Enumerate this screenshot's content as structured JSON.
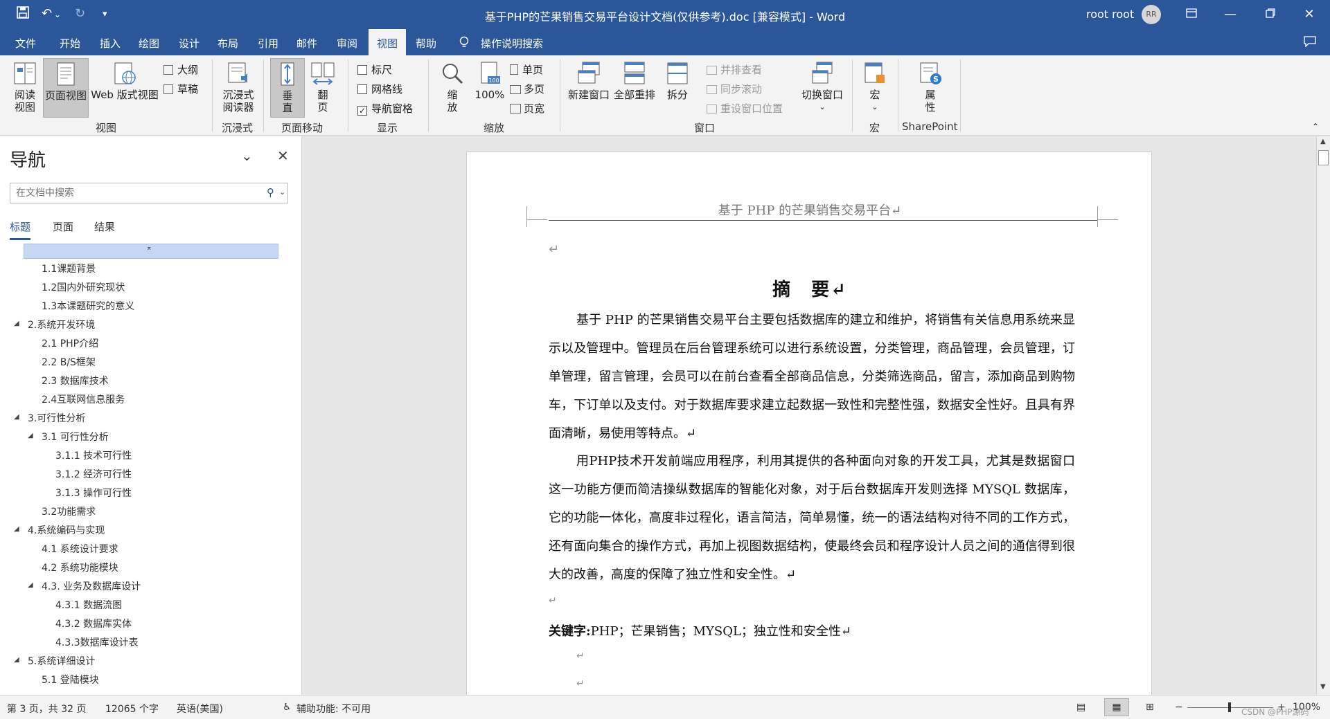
{
  "window": {
    "title": "基于PHP的芒果销售交易平台设计文档(仅供参考).doc [兼容模式]  -  Word",
    "user": "root root",
    "avatar_initials": "RR"
  },
  "menu_tabs": [
    "文件",
    "开始",
    "插入",
    "绘图",
    "设计",
    "布局",
    "引用",
    "邮件",
    "审阅",
    "视图",
    "帮助",
    "操作说明搜索"
  ],
  "ribbon": {
    "views": {
      "read_mode": "阅读\n视图",
      "print_layout": "页面视图",
      "web_layout": "Web 版式视图",
      "outline": "大纲",
      "draft": "草稿",
      "group": "视图"
    },
    "immersive": {
      "reader": "沉浸式\n阅读器",
      "group": "沉浸式"
    },
    "page_movement": {
      "vertical": "垂\n直",
      "side": "翻\n页",
      "group": "页面移动"
    },
    "show": {
      "ruler": "标尺",
      "gridlines": "网格线",
      "nav_pane": "导航窗格",
      "group": "显示"
    },
    "zoom": {
      "zoom": "缩\n放",
      "hundred": "100%",
      "one_page": "单页",
      "multi_page": "多页",
      "page_width": "页宽",
      "group": "缩放"
    },
    "window": {
      "new_window": "新建窗口",
      "arrange_all": "全部重排",
      "split": "拆分",
      "side_by_side": "并排查看",
      "sync_scroll": "同步滚动",
      "reset_pos": "重设窗口位置",
      "switch": "切换窗口",
      "group": "窗口"
    },
    "macros": {
      "macros": "宏",
      "group": "宏"
    },
    "sharepoint": {
      "properties": "属\n性",
      "group": "SharePoint"
    }
  },
  "nav": {
    "title": "导航",
    "search_placeholder": "在文档中搜索",
    "tabs": [
      "标题",
      "页面",
      "结果"
    ],
    "items": [
      {
        "label": "1.1课题背景",
        "level": 2
      },
      {
        "label": "1.2国内外研究现状",
        "level": 2
      },
      {
        "label": "1.3本课题研究的意义",
        "level": 2
      },
      {
        "label": "2.系统开发环境",
        "level": 1
      },
      {
        "label": "2.1 PHP介绍",
        "level": 2
      },
      {
        "label": "2.2 B/S框架",
        "level": 2
      },
      {
        "label": "2.3 数据库技术",
        "level": 2
      },
      {
        "label": "2.4互联网信息服务",
        "level": 2
      },
      {
        "label": "3.可行性分析",
        "level": 1
      },
      {
        "label": "3.1 可行性分析",
        "level": 2,
        "expandable": true
      },
      {
        "label": "3.1.1 技术可行性",
        "level": 3
      },
      {
        "label": "3.1.2 经济可行性",
        "level": 3
      },
      {
        "label": "3.1.3 操作可行性",
        "level": 3
      },
      {
        "label": "3.2功能需求",
        "level": 2
      },
      {
        "label": "4.系统编码与实现",
        "level": 1
      },
      {
        "label": "4.1 系统设计要求",
        "level": 2
      },
      {
        "label": "4.2 系统功能模块",
        "level": 2
      },
      {
        "label": "4.3. 业务及数据库设计",
        "level": 2,
        "expandable": true
      },
      {
        "label": "4.3.1 数据流图",
        "level": 3
      },
      {
        "label": "4.3.2 数据库实体",
        "level": 3
      },
      {
        "label": "4.3.3数据库设计表",
        "level": 3
      },
      {
        "label": "5.系统详细设计",
        "level": 1
      },
      {
        "label": "5.1 登陆模块",
        "level": 2
      }
    ]
  },
  "document": {
    "header": "基于 PHP 的芒果销售交易平台↵",
    "return_mark": "↵",
    "abstract_title": "摘　要↵",
    "para1": "基于 PHP 的芒果销售交易平台主要包括数据库的建立和维护，将销售有关信息用系统来显示以及管理中。管理员在后台管理系统可以进行系统设置，分类管理，商品管理，会员管理，订单管理，留言管理，会员可以在前台查看全部商品信息，分类筛选商品，留言，添加商品到购物车，下订单以及支付。对于数据库要求建立起数据一致性和完整性强，数据安全性好。且具有界面清晰，易使用等特点。↵",
    "para2": "用PHP技术开发前端应用程序，利用其提供的各种面向对象的开发工具，尤其是数据窗口这一功能方便而简洁操纵数据库的智能化对象，对于后台数据库开发则选择 MYSQL 数据库，它的功能一体化，高度非过程化，语言简洁，简单易懂，统一的语法结构对待不同的工作方式，还有面向集合的操作方式，再加上视图数据结构，使最终会员和程序设计人员之间的通信得到很大的改善，高度的保障了独立性和安全性。↵",
    "keywords_label": "关键字:",
    "keywords": "PHP；芒果销售；MYSQL；独立性和安全性↵"
  },
  "status": {
    "page": "第 3 页，共 32 页",
    "words": "12065 个字",
    "language": "英语(美国)",
    "accessibility": "辅助功能: 不可用",
    "zoom": "100%",
    "watermark": "CSDN @PHP源码"
  }
}
